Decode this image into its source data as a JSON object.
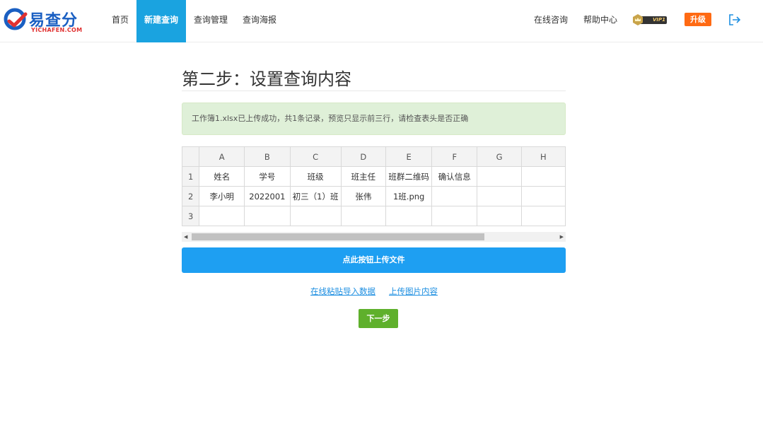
{
  "header": {
    "logo_text": "易查分",
    "logo_sub": "YICHAFEN.COM",
    "nav": [
      {
        "label": "首页"
      },
      {
        "label": "新建查询"
      },
      {
        "label": "查询管理"
      },
      {
        "label": "查询海报"
      }
    ],
    "right_links": [
      {
        "label": "在线咨询"
      },
      {
        "label": "帮助中心"
      }
    ],
    "vip_label": "VIP1",
    "upgrade_label": "升级",
    "colors": {
      "nav_active": "#1aa3e0",
      "upgrade": "#ff6a13",
      "brand": "#1a5fc2"
    }
  },
  "main": {
    "title": "第二步：设置查询内容",
    "alert": "工作簿1.xlsx已上传成功，共1条记录，预览只显示前三行，请检查表头是否正确",
    "sheet": {
      "columns": [
        "A",
        "B",
        "C",
        "D",
        "E",
        "F",
        "G",
        "H"
      ],
      "rows": [
        {
          "num": "1",
          "cells": [
            "姓名",
            "学号",
            "班级",
            "班主任",
            "班群二维码",
            "确认信息",
            "",
            ""
          ]
        },
        {
          "num": "2",
          "cells": [
            "李小明",
            "2022001",
            "初三（1）班",
            "张伟",
            "1班.png",
            "",
            "",
            ""
          ]
        },
        {
          "num": "3",
          "cells": [
            "",
            "",
            "",
            "",
            "",
            "",
            "",
            ""
          ]
        }
      ]
    },
    "upload_label": "点此按钮上传文件",
    "paste_link": "在线粘贴导入数据",
    "image_link": "上传图片内容",
    "next_label": "下一步",
    "colors": {
      "upload": "#1e9ff2",
      "next": "#5fb02c",
      "alert_bg": "#dff0d8"
    }
  }
}
